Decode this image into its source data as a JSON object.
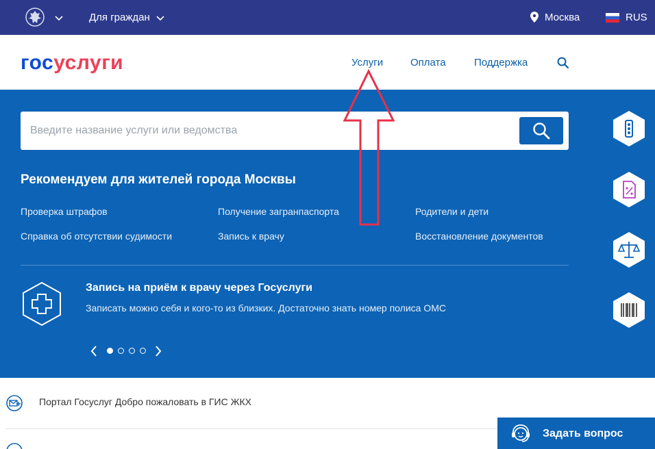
{
  "topbar": {
    "citizens": "Для граждан",
    "city": "Москва",
    "lang": "RUS"
  },
  "header": {
    "logo_part1": "гос",
    "logo_part2": "услуги",
    "nav": [
      "Услуги",
      "Оплата",
      "Поддержка"
    ]
  },
  "search": {
    "placeholder": "Введите название услуги или ведомства",
    "value": ""
  },
  "recommend": {
    "title": "Рекомендуем для жителей города Москвы",
    "links": [
      "Проверка штрафов",
      "Получение загранпаспорта",
      "Родители и дети",
      "Справка об отсутствии судимости",
      "Запись к врачу",
      "Восстановление документов"
    ]
  },
  "promo": {
    "title": "Запись на приём к врачу через Госуслуги",
    "text": "Записать можно себя и кого-то из близких. Достаточно знать номер полиса ОМС",
    "pager_active": 0,
    "pager_count": 4
  },
  "side_icons": [
    "traffic-light-icon",
    "percent-document-icon",
    "scales-icon",
    "barcode-icon"
  ],
  "feed": {
    "item1": "Портал Госуслуг Добро пожаловать в ГИС ЖКХ"
  },
  "ask": {
    "label": "Задать вопрос"
  },
  "colors": {
    "topbar": "#2d3a8c",
    "hero": "#0d63b5",
    "logo_blue": "#0d4cd3",
    "logo_red": "#ee3f58",
    "arrow": "#e8304a"
  }
}
